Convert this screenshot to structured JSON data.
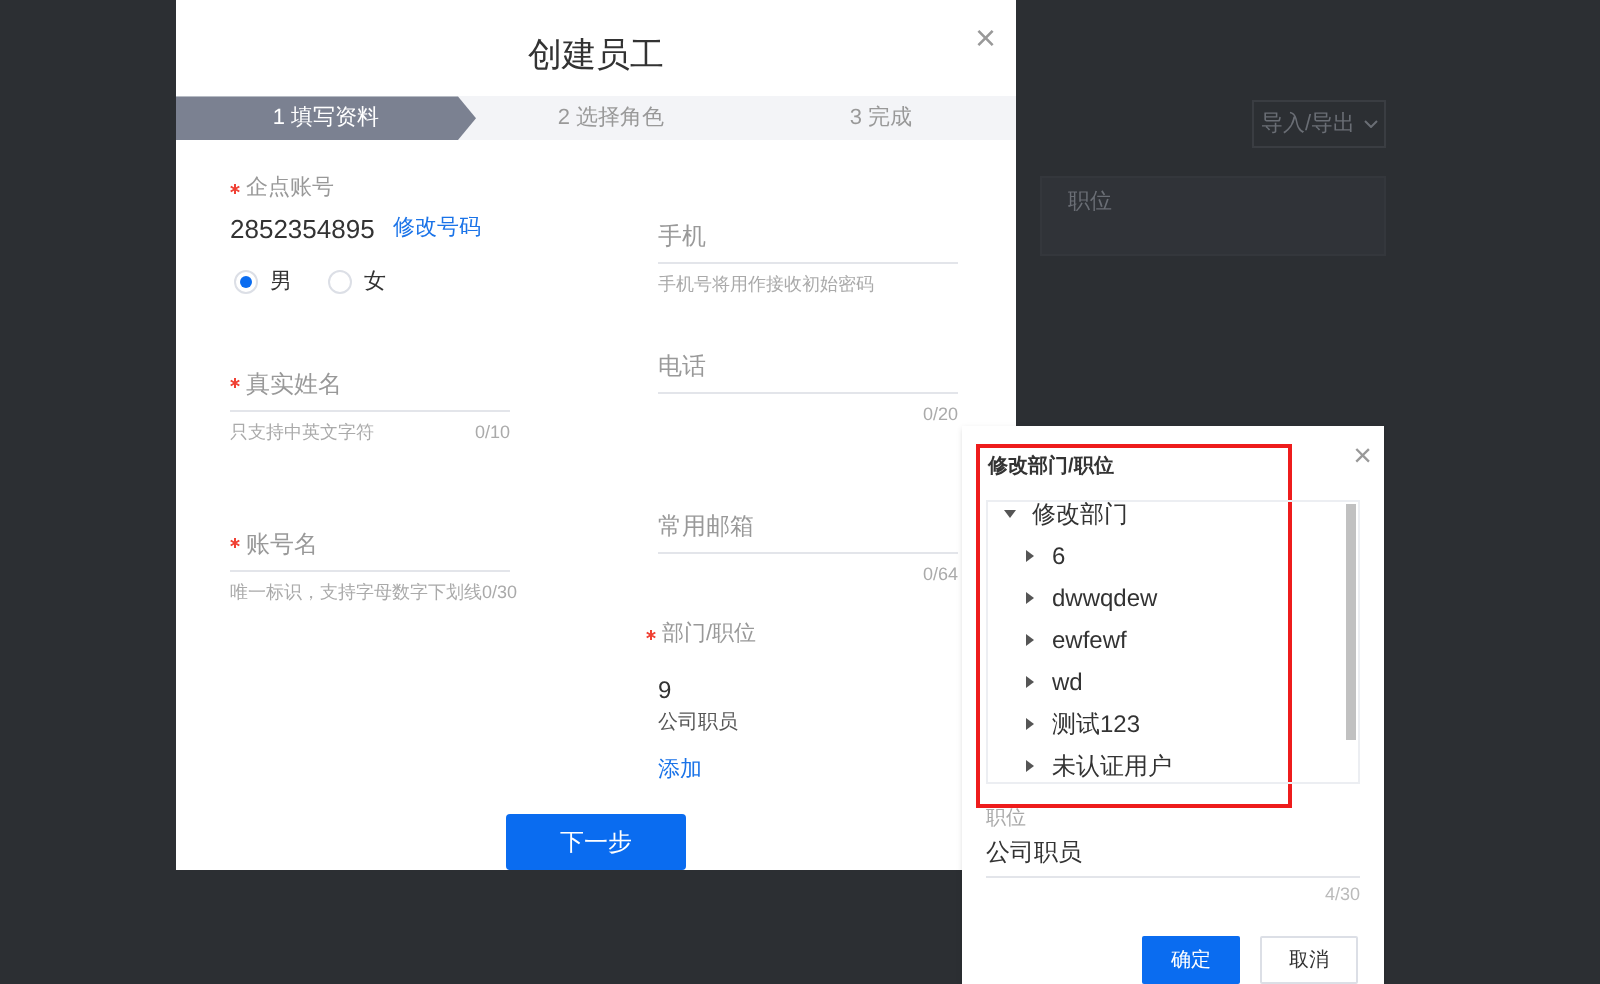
{
  "background": {
    "import_export_button": "导入/导出",
    "position_label": "职位"
  },
  "dialog": {
    "title": "创建员工",
    "close": "×",
    "steps": [
      {
        "label": "1 填写资料",
        "selected": true
      },
      {
        "label": "2 选择角色",
        "selected": false
      },
      {
        "label": "3 完成",
        "selected": false
      }
    ],
    "account": {
      "label": "企点账号",
      "required": true,
      "value": "2852354895",
      "link": "修改号码"
    },
    "gender": [
      {
        "label": "男",
        "selected": true
      },
      {
        "label": "女",
        "selected": false
      }
    ],
    "fields_left": [
      {
        "label": "真实姓名",
        "required": true,
        "hint": "只支持中英文字符",
        "count": "0/10"
      },
      {
        "label": "账号名",
        "required": true,
        "hint": "唯一标识，支持字母数字下划线",
        "count": "0/30"
      }
    ],
    "fields_right": [
      {
        "label": "手机",
        "required": false,
        "hint": "手机号将用作接收初始密码"
      },
      {
        "label": "电话",
        "required": false,
        "count": "0/20"
      },
      {
        "label": "常用邮箱",
        "required": false,
        "count": "0/64"
      }
    ],
    "department": {
      "label": "部门/职位",
      "required": true,
      "value": "9",
      "position": "公司职员",
      "link": "添加"
    },
    "next_button": "下一步"
  },
  "popup": {
    "title": "修改部门/职位",
    "close": "×",
    "tree": [
      {
        "label": "修改部门",
        "expanded": true,
        "children": [
          {
            "label": "6",
            "expanded": false
          },
          {
            "label": "dwwqdew",
            "expanded": false
          },
          {
            "label": "ewfewf",
            "expanded": false
          },
          {
            "label": "wd",
            "expanded": false
          },
          {
            "label": "测试123",
            "expanded": false
          },
          {
            "label": "未认证用户",
            "expanded": false
          }
        ]
      }
    ],
    "position_label": "职位",
    "position_value": "公司职员",
    "count": "4/30",
    "buttons": [
      {
        "label": "确定",
        "kind": "primary"
      },
      {
        "label": "取消",
        "kind": "secondary"
      }
    ]
  }
}
